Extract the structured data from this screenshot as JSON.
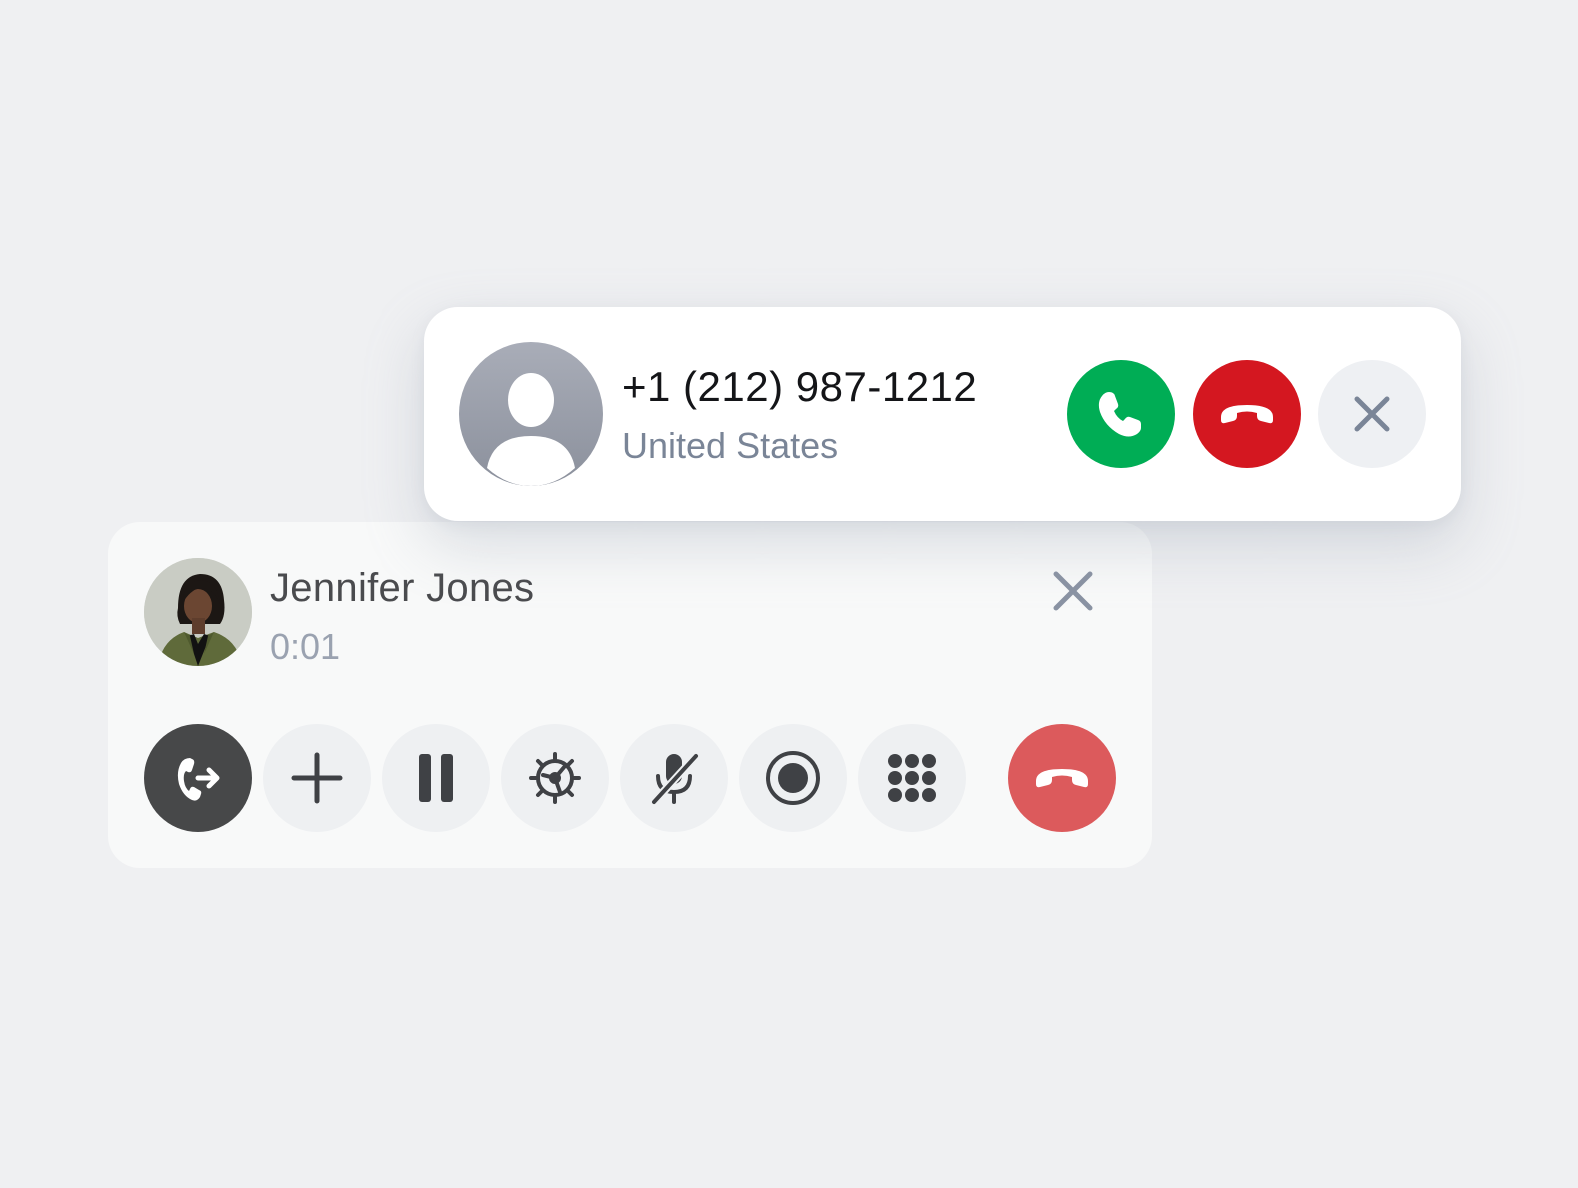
{
  "incoming_call": {
    "number": "+1 (212) 987-1212",
    "location": "United States",
    "avatar_icon": "generic-user-icon",
    "actions": {
      "accept": {
        "icon": "phone-icon",
        "color": "#00ad55"
      },
      "decline": {
        "icon": "hang-up-icon",
        "color": "#d41720"
      },
      "dismiss": {
        "icon": "close-icon"
      }
    }
  },
  "active_call": {
    "caller_name": "Jennifer Jones",
    "duration": "0:01",
    "avatar": "caller-photo",
    "controls": [
      {
        "id": "transfer",
        "icon": "call-transfer-icon",
        "active": true
      },
      {
        "id": "add",
        "icon": "plus-icon"
      },
      {
        "id": "hold",
        "icon": "pause-icon"
      },
      {
        "id": "settings",
        "icon": "gear-icon"
      },
      {
        "id": "mute",
        "icon": "microphone-off-icon"
      },
      {
        "id": "record",
        "icon": "record-icon"
      },
      {
        "id": "keypad",
        "icon": "dialpad-icon"
      },
      {
        "id": "end",
        "icon": "hang-up-icon",
        "color": "#dc5a5c"
      }
    ],
    "close_icon": "close-icon"
  },
  "colors": {
    "background": "#eff0f2",
    "accept_green": "#00ad55",
    "decline_red": "#d41720",
    "end_call_red": "#dc5a5c",
    "muted_text": "#7a8597",
    "dark_control": "#474849"
  }
}
